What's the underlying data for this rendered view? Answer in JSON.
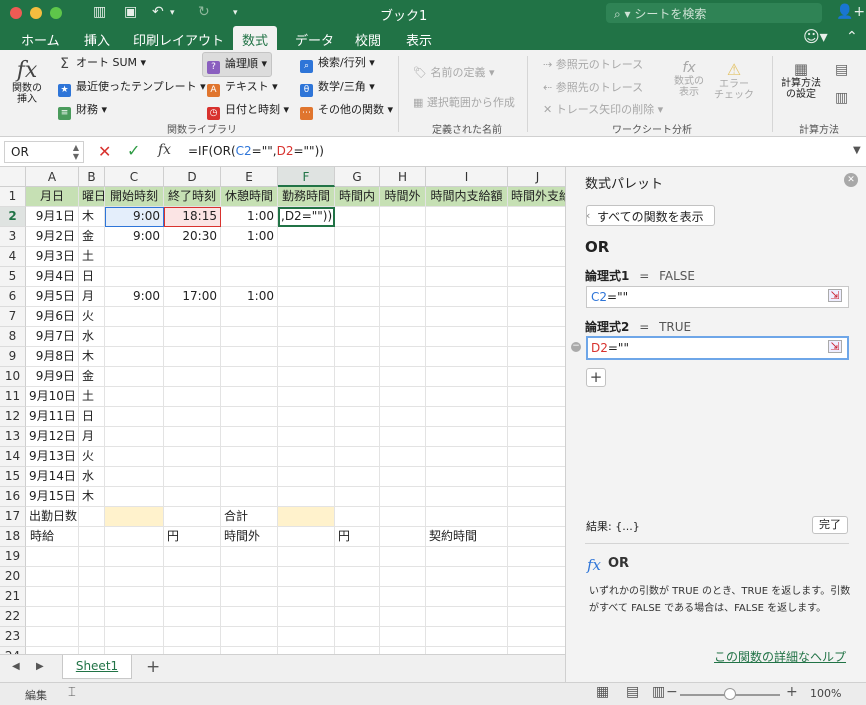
{
  "app": {
    "doc_title": "ブック1",
    "search_placeholder": "シートを検索"
  },
  "ribbon_tabs": [
    {
      "label": "ホーム"
    },
    {
      "label": "挿入"
    },
    {
      "label": "印刷レイアウト"
    },
    {
      "label": "数式",
      "active": true
    },
    {
      "label": "データ"
    },
    {
      "label": "校閲"
    },
    {
      "label": "表示"
    }
  ],
  "ribbon": {
    "insert_function": "関数の\n挿入",
    "lib": [
      {
        "label": "オート SUM",
        "icon": "sigma-icon"
      },
      {
        "label": "最近使ったテンプレート",
        "icon": "star-icon"
      },
      {
        "label": "財務",
        "icon": "financial-icon"
      },
      {
        "label": "論理順",
        "icon": "question-icon"
      },
      {
        "label": "テキスト",
        "icon": "text-a-icon"
      },
      {
        "label": "日付と時刻",
        "icon": "clock-icon"
      },
      {
        "label": "検索/行列",
        "icon": "lookup-icon"
      },
      {
        "label": "数学/三角",
        "icon": "math-icon"
      },
      {
        "label": "その他の関数",
        "icon": "more-functions-icon"
      }
    ],
    "lib_group": "関数ライブラリ",
    "names": [
      {
        "label": "名前の定義"
      },
      {
        "label": "選択範囲から作成"
      }
    ],
    "names_group": "定義された名前",
    "audit": [
      {
        "label": "参照元のトレース"
      },
      {
        "label": "参照先のトレース"
      },
      {
        "label": "トレース矢印の削除"
      }
    ],
    "show_formulas": "数式の\n表示",
    "error_check": "エラー\nチェック",
    "audit_group": "ワークシート分析",
    "calc_options": "計算方法\nの設定",
    "calc_group": "計算方法"
  },
  "formula_bar": {
    "name_box": "OR",
    "fx": "fx",
    "formula": [
      {
        "t": "=IF(OR(",
        "c": "#222"
      },
      {
        "t": "C2",
        "c": "#2e75d8"
      },
      {
        "t": "=\"\",",
        "c": "#222"
      },
      {
        "t": "D2",
        "c": "#d8322e"
      },
      {
        "t": "=\"\"))",
        "c": "#222"
      }
    ]
  },
  "grid": {
    "col_headers": [
      "A",
      "B",
      "C",
      "D",
      "E",
      "F",
      "G",
      "H",
      "I",
      "J"
    ],
    "row_headers": [
      "1",
      "2",
      "3",
      "4",
      "5",
      "6",
      "7",
      "8",
      "9",
      "10",
      "11",
      "12",
      "13",
      "14",
      "15",
      "16",
      "17",
      "18",
      "19",
      "20",
      "21",
      "22",
      "23",
      "24"
    ],
    "rows": [
      [
        "月日",
        "曜日",
        "開始時刻",
        "終了時刻",
        "休憩時間",
        "勤務時間",
        "時間内",
        "時間外",
        "時間内支給額",
        "時間外支給"
      ],
      [
        "9月1日",
        "木",
        "9:00",
        "18:15",
        "1:00",
        ",D2=\"\"))",
        "",
        "",
        "",
        ""
      ],
      [
        "9月2日",
        "金",
        "9:00",
        "20:30",
        "1:00",
        "",
        "",
        "",
        "",
        ""
      ],
      [
        "9月3日",
        "土",
        "",
        "",
        "",
        "",
        "",
        "",
        "",
        ""
      ],
      [
        "9月4日",
        "日",
        "",
        "",
        "",
        "",
        "",
        "",
        "",
        ""
      ],
      [
        "9月5日",
        "月",
        "9:00",
        "17:00",
        "1:00",
        "",
        "",
        "",
        "",
        ""
      ],
      [
        "9月6日",
        "火",
        "",
        "",
        "",
        "",
        "",
        "",
        "",
        ""
      ],
      [
        "9月7日",
        "水",
        "",
        "",
        "",
        "",
        "",
        "",
        "",
        ""
      ],
      [
        "9月8日",
        "木",
        "",
        "",
        "",
        "",
        "",
        "",
        "",
        ""
      ],
      [
        "9月9日",
        "金",
        "",
        "",
        "",
        "",
        "",
        "",
        "",
        ""
      ],
      [
        "9月10日",
        "土",
        "",
        "",
        "",
        "",
        "",
        "",
        "",
        ""
      ],
      [
        "9月11日",
        "日",
        "",
        "",
        "",
        "",
        "",
        "",
        "",
        ""
      ],
      [
        "9月12日",
        "月",
        "",
        "",
        "",
        "",
        "",
        "",
        "",
        ""
      ],
      [
        "9月13日",
        "火",
        "",
        "",
        "",
        "",
        "",
        "",
        "",
        ""
      ],
      [
        "9月14日",
        "水",
        "",
        "",
        "",
        "",
        "",
        "",
        "",
        ""
      ],
      [
        "9月15日",
        "木",
        "",
        "",
        "",
        "",
        "",
        "",
        "",
        ""
      ],
      [
        "出勤日数",
        "",
        "",
        "",
        "合計",
        "",
        "",
        "",
        "",
        ""
      ],
      [
        "時給",
        "",
        "",
        "円",
        "時間外",
        "",
        "円",
        "",
        "契約時間",
        ""
      ],
      [
        "",
        "",
        "",
        "",
        "",
        "",
        "",
        "",
        "",
        ""
      ],
      [
        "",
        "",
        "",
        "",
        "",
        "",
        "",
        "",
        "",
        ""
      ],
      [
        "",
        "",
        "",
        "",
        "",
        "",
        "",
        "",
        "",
        ""
      ],
      [
        "",
        "",
        "",
        "",
        "",
        "",
        "",
        "",
        "",
        ""
      ],
      [
        "",
        "",
        "",
        "",
        "",
        "",
        "",
        "",
        "",
        ""
      ],
      [
        "",
        "",
        "",
        "",
        "",
        "",
        "",
        "",
        "",
        ""
      ]
    ],
    "header_fill": "#c6e0b4",
    "highlight_fill": "#fff2cc"
  },
  "palette": {
    "title": "数式パレット",
    "show_all": "すべての関数を表示",
    "func_name": "OR",
    "arg1_label": "論理式1",
    "arg1_result": "FALSE",
    "arg2_label": "論理式2",
    "arg2_result": "TRUE",
    "arg1_value": [
      {
        "t": "C2",
        "c": "#2e75d8"
      },
      {
        "t": "=\"\"",
        "c": "#222"
      }
    ],
    "arg2_value": [
      {
        "t": "D2",
        "c": "#d8322e"
      },
      {
        "t": "=\"\"",
        "c": "#222"
      }
    ],
    "eq": "=",
    "result_label": "結果: {...}",
    "done": "完了",
    "desc_title": "OR",
    "desc": "いずれかの引数が TRUE のとき、TRUE を返します。引数がすべて FALSE である場合は、FALSE を返します。",
    "help_link": "この関数の詳細なヘルプ"
  },
  "sheets": [
    {
      "name": "Sheet1"
    }
  ],
  "status": {
    "mode": "編集",
    "zoom": "100%"
  }
}
